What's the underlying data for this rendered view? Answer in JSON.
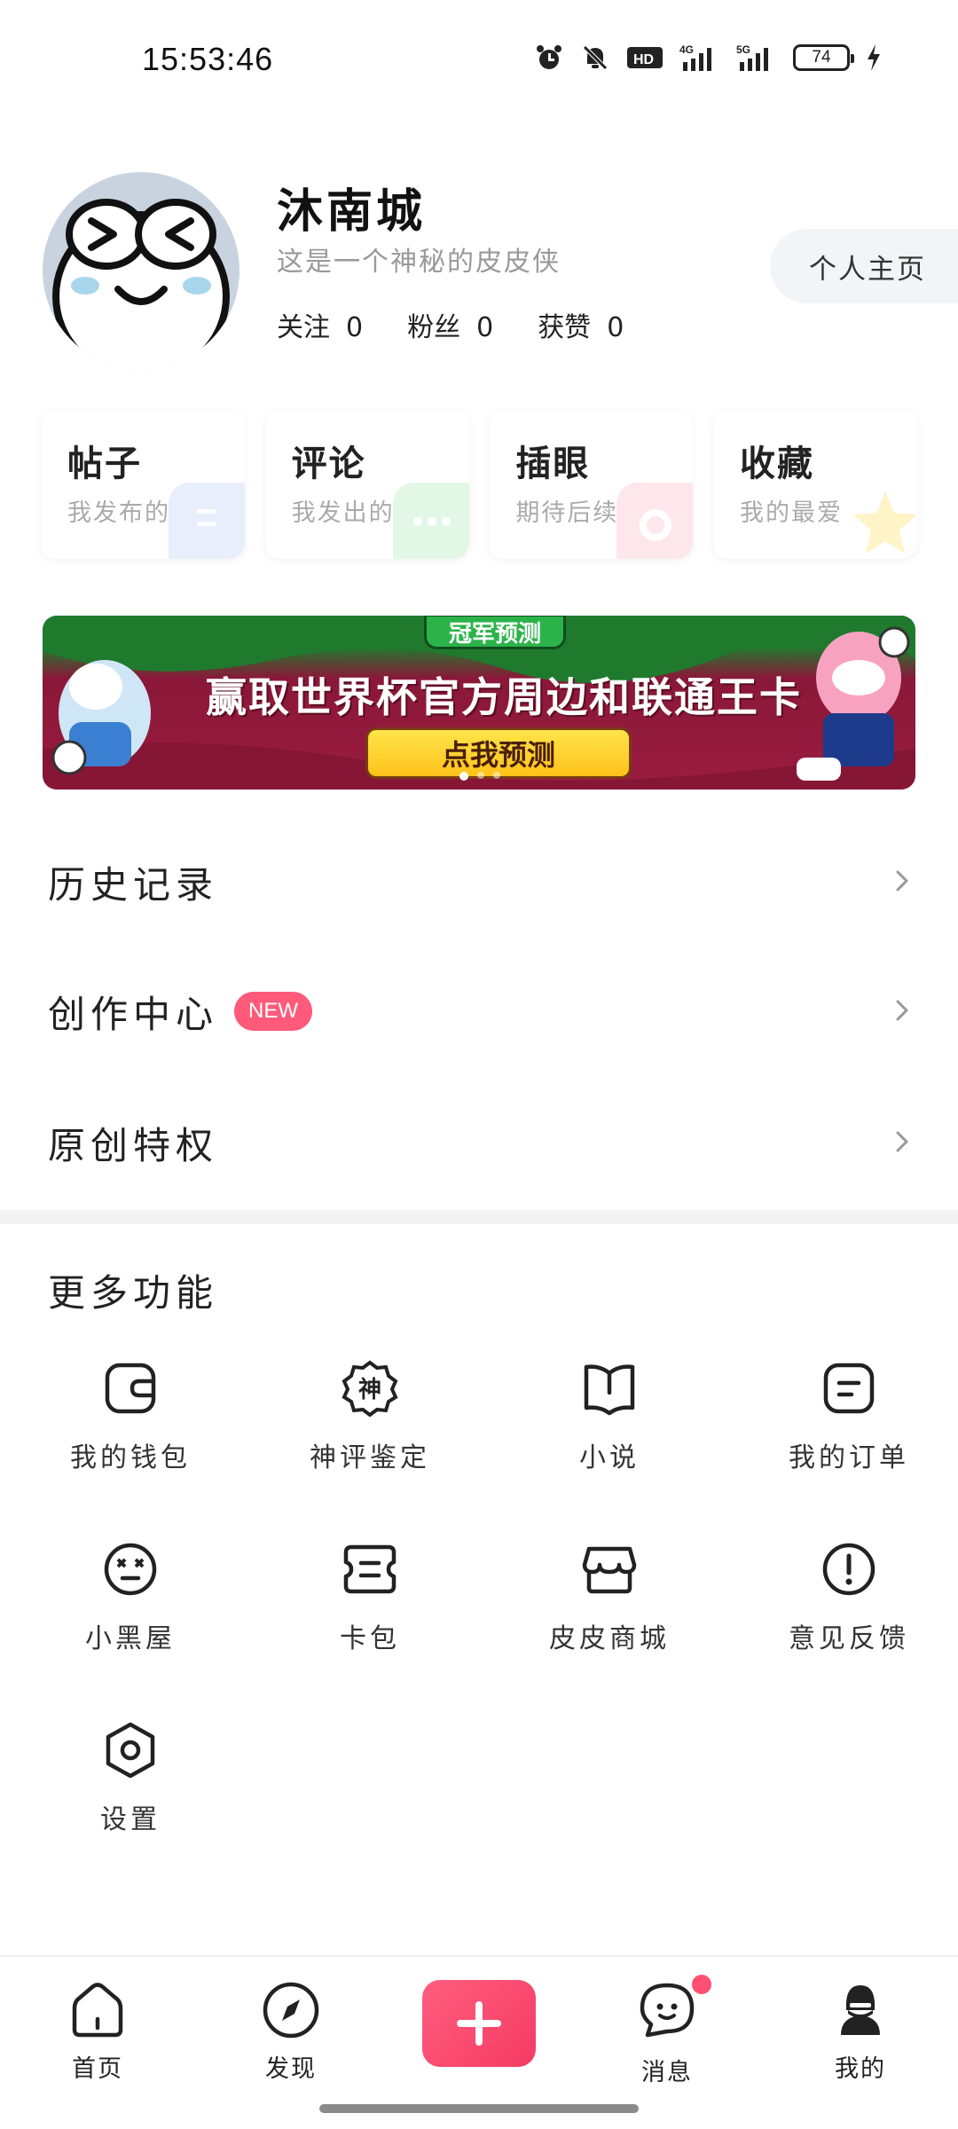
{
  "status_bar": {
    "time": "15:53:46",
    "battery": "74",
    "network_4g": "4G",
    "network_5g": "5G",
    "hd": "HD"
  },
  "profile": {
    "name": "沐南城",
    "bio": "这是一个神秘的皮皮侠",
    "home_button": "个人主页",
    "stats": [
      {
        "label": "关注",
        "value": "0"
      },
      {
        "label": "粉丝",
        "value": "0"
      },
      {
        "label": "获赞",
        "value": "0"
      }
    ]
  },
  "cards": [
    {
      "title": "帖子",
      "sub": "我发布的",
      "color": "#e9eefc"
    },
    {
      "title": "评论",
      "sub": "我发出的",
      "color": "#e3f7e6"
    },
    {
      "title": "插眼",
      "sub": "期待后续",
      "color": "#fde7ea"
    },
    {
      "title": "收藏",
      "sub": "我的最爱",
      "color": "#fff5d6"
    }
  ],
  "banner": {
    "tag": "冠军预测",
    "title": "赢取世界杯官方周边和联通王卡",
    "button": "点我预测"
  },
  "menu": {
    "history": "历史记录",
    "creation": "创作中心",
    "creation_badge": "NEW",
    "original": "原创特权"
  },
  "more": {
    "title": "更多功能",
    "items": [
      {
        "label": "我的钱包",
        "icon": "wallet-icon"
      },
      {
        "label": "神评鉴定",
        "icon": "shen-badge-icon",
        "glyph": "神"
      },
      {
        "label": "小说",
        "icon": "book-icon"
      },
      {
        "label": "我的订单",
        "icon": "order-icon"
      },
      {
        "label": "小黑屋",
        "icon": "dizzy-face-icon"
      },
      {
        "label": "卡包",
        "icon": "card-pack-icon"
      },
      {
        "label": "皮皮商城",
        "icon": "shop-icon"
      },
      {
        "label": "意见反馈",
        "icon": "feedback-icon"
      },
      {
        "label": "设置",
        "icon": "settings-icon"
      }
    ]
  },
  "nav": {
    "home": "首页",
    "discover": "发现",
    "messages": "消息",
    "mine": "我的"
  },
  "colors": {
    "accent": "#f53a63",
    "badge": "#ff5a7a"
  }
}
